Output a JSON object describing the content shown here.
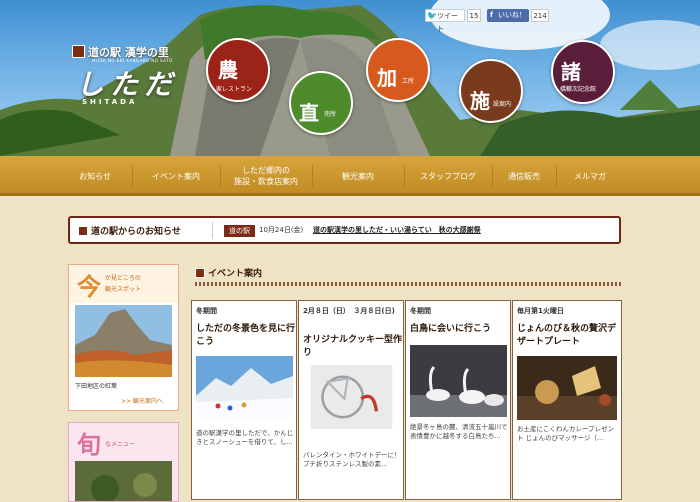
{
  "social": {
    "tweet_label": "ツイート",
    "tweet_count": "15",
    "like_label": "いいね！",
    "like_count": "214"
  },
  "logo": {
    "top": "道の駅 漢学の里",
    "sub": "MICHI NO EKI   KANGAKU NO SATO",
    "main": "しただ",
    "roman": "SHITADA"
  },
  "circles": [
    {
      "big": "農",
      "small": "家レストラン",
      "color": "#9b2318"
    },
    {
      "big": "直",
      "small": "売所",
      "color": "#4e8b2b"
    },
    {
      "big": "加",
      "small": "工所",
      "color": "#d65a1d"
    },
    {
      "big": "施",
      "small": "設案内",
      "color": "#7a3a1e"
    },
    {
      "big": "諸",
      "small": "橋轍次記念館",
      "color": "#5a1d3a"
    }
  ],
  "nav": [
    {
      "label": "お知らせ"
    },
    {
      "label": "イベント案内"
    },
    {
      "label1": "しただ郷内の",
      "label2": "施設・飲食店案内"
    },
    {
      "label": "観光案内"
    },
    {
      "label": "スタッフブログ"
    },
    {
      "label": "通信販売"
    },
    {
      "label": "メルマガ"
    }
  ],
  "news": {
    "title": "道の駅からのお知らせ",
    "tag": "道の駅",
    "date": "10月24日(金)",
    "headline": "道の駅漢学の里しただ・いい湯らてい　秋の大感謝祭"
  },
  "sidebar": {
    "spot_big": "今",
    "spot_caption1": "が見どころの",
    "spot_caption2": "観光スポット",
    "spot_photo_caption": "下田地区の紅葉",
    "spot_link": ">> 観光案内へ",
    "menu_big": "旬",
    "menu_caption": "なメニュー"
  },
  "events_section": {
    "title": "イベント案内"
  },
  "events": [
    {
      "date": "冬期間",
      "title": "しただの冬景色を見に行こう",
      "desc": "道の駅漢学の里しただで、かんじきとスノーシューを借りて、し..."
    },
    {
      "date": "2月８日（日）　３月８日(日)",
      "title": "オリジナルクッキー型作り",
      "desc": "バレンタイン・ホワイトデーに！ ブチ折りステンレス製の素..."
    },
    {
      "date": "冬期間",
      "title": "白鳥に会いに行こう",
      "desc": "絶景冬ヶ島の麓、清流五十嵐川で表情豊かに越冬する白鳥たち..."
    },
    {
      "date": "毎月第1火曜日",
      "title": "じょんのび＆秋の贅沢デザートプレート",
      "desc": "お土産にこくわんカレープレゼント じょんのびマッサージ（..."
    }
  ]
}
